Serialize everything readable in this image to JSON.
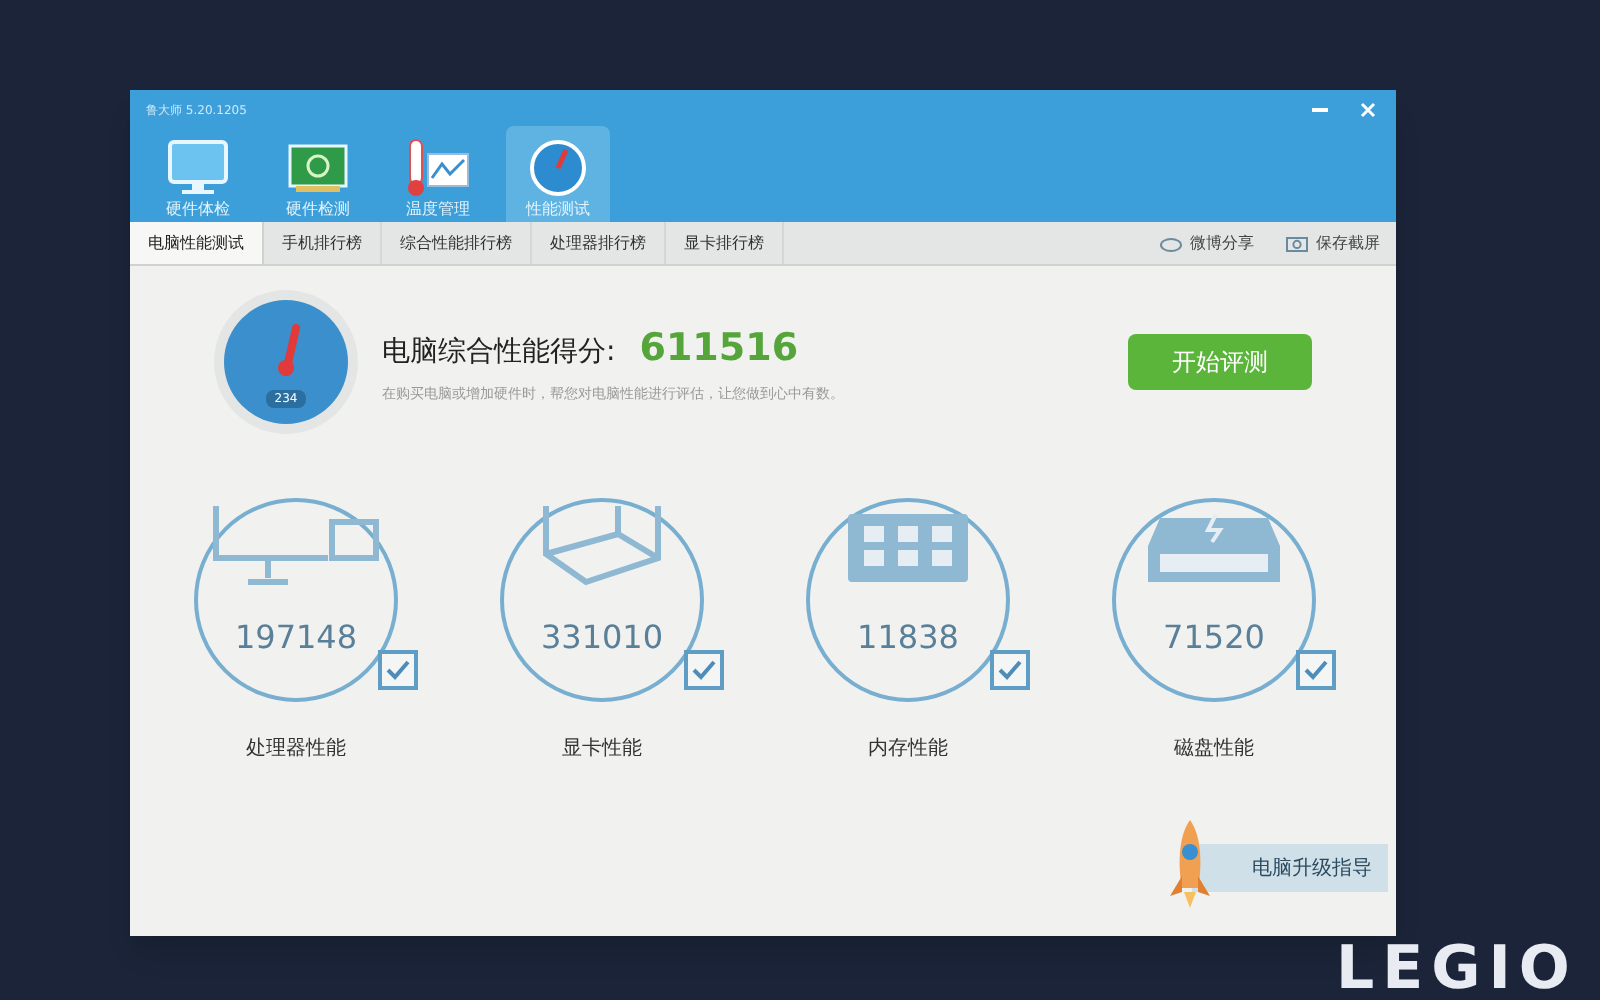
{
  "window": {
    "title": "鲁大师 5.20.1205"
  },
  "nav": [
    {
      "label": "硬件体检",
      "kind": "monitor",
      "selected": false
    },
    {
      "label": "硬件检测",
      "kind": "board",
      "selected": false
    },
    {
      "label": "温度管理",
      "kind": "thermo",
      "selected": false
    },
    {
      "label": "性能测试",
      "kind": "gauge",
      "selected": true
    }
  ],
  "tabs": [
    {
      "label": "电脑性能测试",
      "selected": true
    },
    {
      "label": "手机排行榜",
      "selected": false
    },
    {
      "label": "综合性能排行榜",
      "selected": false
    },
    {
      "label": "处理器排行榜",
      "selected": false
    },
    {
      "label": "显卡排行榜",
      "selected": false
    }
  ],
  "actions": [
    {
      "label": "微博分享",
      "kind": "share"
    },
    {
      "label": "保存截屏",
      "kind": "camera"
    }
  ],
  "score": {
    "title": "电脑综合性能得分:",
    "value": "611516",
    "description": "在购买电脑或增加硬件时，帮您对电脑性能进行评估，让您做到心中有数。",
    "gauge_text": "234",
    "button": "开始评测"
  },
  "components": [
    {
      "kind": "cpu",
      "value": "197148",
      "label": "处理器性能",
      "checked": true
    },
    {
      "kind": "gpu",
      "value": "331010",
      "label": "显卡性能",
      "checked": true
    },
    {
      "kind": "ram",
      "value": "11838",
      "label": "内存性能",
      "checked": true
    },
    {
      "kind": "disk",
      "value": "71520",
      "label": "磁盘性能",
      "checked": true
    }
  ],
  "upgrade_link": "电脑升级指导",
  "bezel_logo": "LEGIO"
}
